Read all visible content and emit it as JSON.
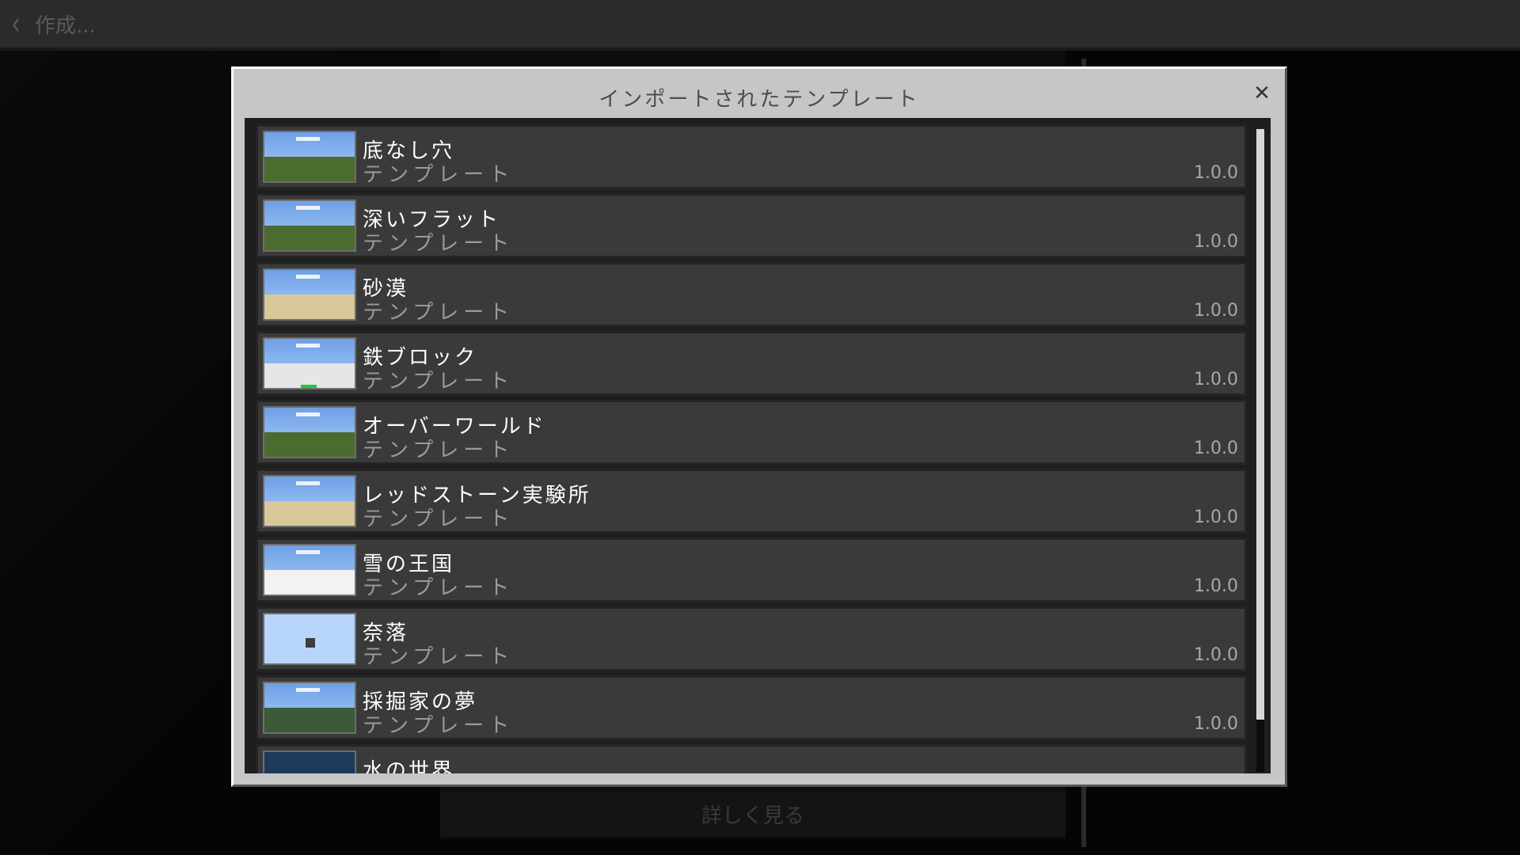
{
  "topbar": {
    "back_label": "作成..."
  },
  "background": {
    "button_label": "詳しく見る"
  },
  "dialog": {
    "title": "インポートされたテンプレート",
    "close_icon": "close-icon",
    "items": [
      {
        "name": "底なし穴",
        "subtitle": "テンプレート",
        "version": "1.0.0",
        "thumb": "grass"
      },
      {
        "name": "深いフラット",
        "subtitle": "テンプレート",
        "version": "1.0.0",
        "thumb": "grass"
      },
      {
        "name": "砂漠",
        "subtitle": "テンプレート",
        "version": "1.0.0",
        "thumb": "sand"
      },
      {
        "name": "鉄ブロック",
        "subtitle": "テンプレート",
        "version": "1.0.0",
        "thumb": "iron"
      },
      {
        "name": "オーバーワールド",
        "subtitle": "テンプレート",
        "version": "1.0.0",
        "thumb": "grass"
      },
      {
        "name": "レッドストーン実験所",
        "subtitle": "テンプレート",
        "version": "1.0.0",
        "thumb": "sand"
      },
      {
        "name": "雪の王国",
        "subtitle": "テンプレート",
        "version": "1.0.0",
        "thumb": "snow"
      },
      {
        "name": "奈落",
        "subtitle": "テンプレート",
        "version": "1.0.0",
        "thumb": "void"
      },
      {
        "name": "採掘家の夢",
        "subtitle": "テンプレート",
        "version": "1.0.0",
        "thumb": "dark-grass"
      },
      {
        "name": "水の世界",
        "subtitle": "",
        "version": "",
        "thumb": "water"
      }
    ]
  },
  "colors": {
    "sky": "#8cb8f0",
    "grass": "#4b6b2f",
    "sand": "#d9c89a",
    "snow": "#f2f2f2",
    "void": "#b8d6fb",
    "dark_grass": "#3c5a35",
    "water": "#1c3a5c"
  }
}
